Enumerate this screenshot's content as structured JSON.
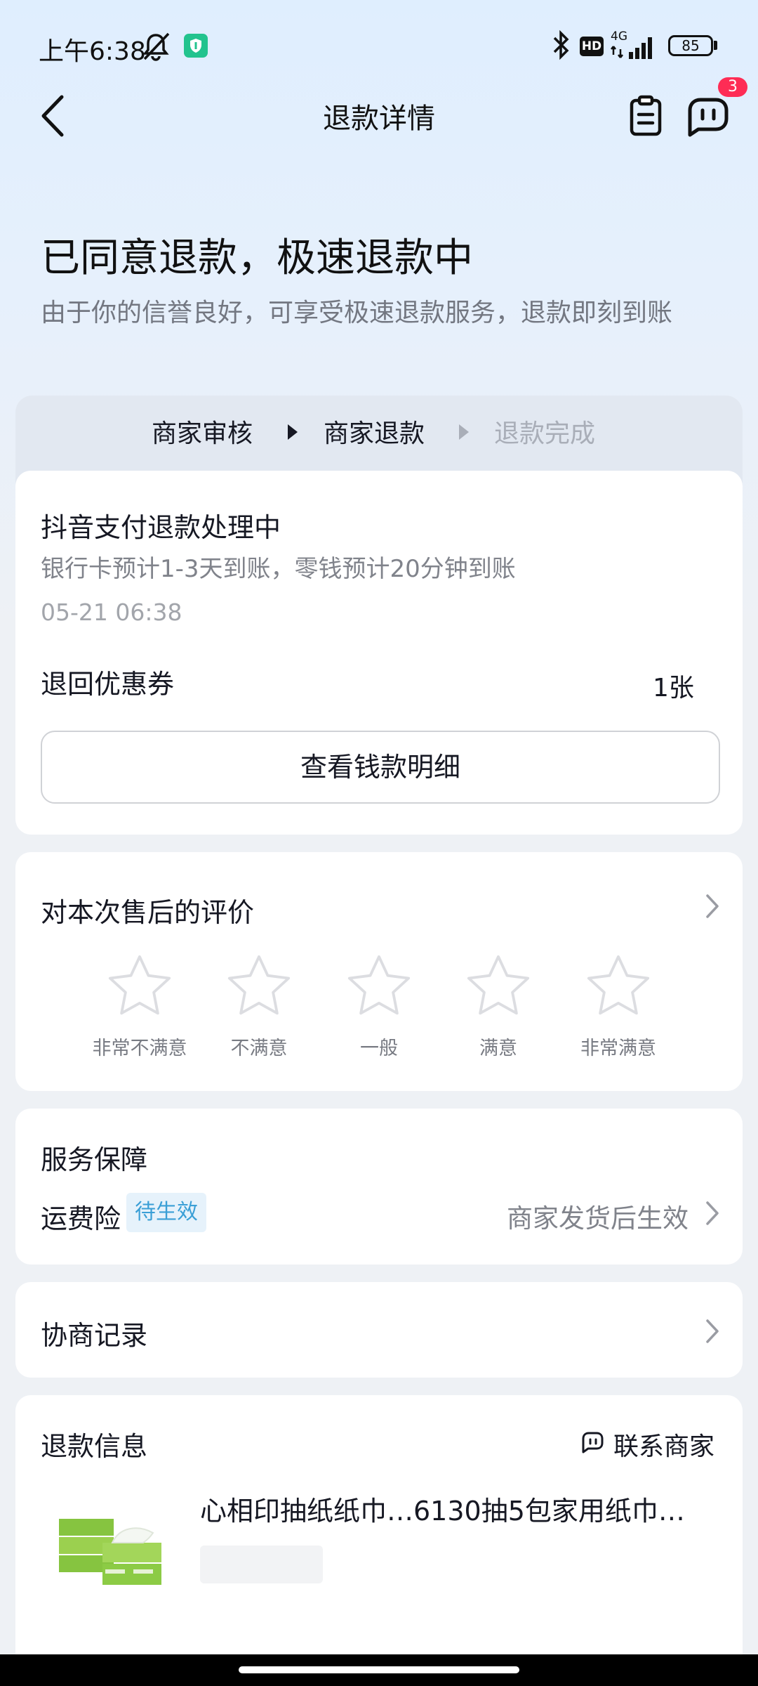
{
  "status_bar": {
    "time": "上午6:38",
    "network": "4G",
    "hd": "HD",
    "battery": "85"
  },
  "nav": {
    "title": "退款详情",
    "badge_count": "3"
  },
  "hero": {
    "title": "已同意退款，极速退款中",
    "subtitle": "由于你的信誉良好，可享受极速退款服务，退款即刻到账"
  },
  "progress": {
    "steps": [
      {
        "label": "商家审核",
        "state": "done"
      },
      {
        "label": "商家退款",
        "state": "done"
      },
      {
        "label": "退款完成",
        "state": "pending"
      }
    ]
  },
  "refund_status": {
    "title": "抖音支付退款处理中",
    "description": "银行卡预计1-3天到账，零钱预计20分钟到账",
    "timestamp": "05-21 06:38",
    "coupon_label": "退回优惠券",
    "coupon_value": "1张",
    "detail_button": "查看钱款明细"
  },
  "rating": {
    "title": "对本次售后的评价",
    "options": [
      "非常不满意",
      "不满意",
      "一般",
      "满意",
      "非常满意"
    ]
  },
  "service": {
    "title": "服务保障",
    "item_label": "运费险",
    "item_tag": "待生效",
    "item_status": "商家发货后生效"
  },
  "negotiation": {
    "title": "协商记录"
  },
  "refund_info": {
    "title": "退款信息",
    "contact": "联系商家",
    "product_name": "心相印抽纸纸巾…6130抽5包家用纸巾…"
  },
  "colors": {
    "accent_red": "#fe2c55",
    "tag_blue": "#3a9fd6",
    "shield_green": "#22c38e"
  }
}
